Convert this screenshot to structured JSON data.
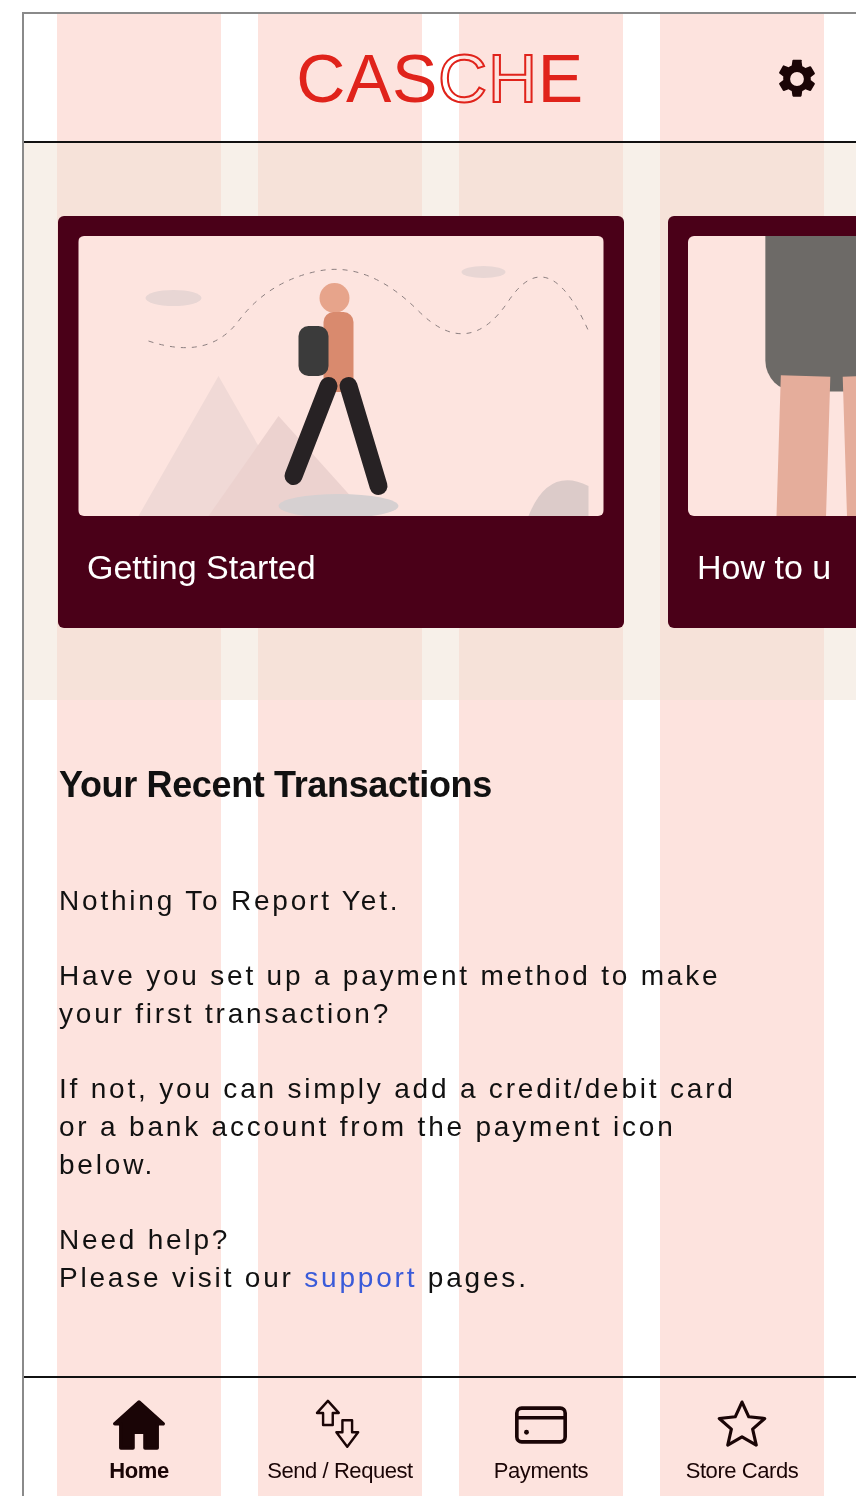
{
  "logo": [
    {
      "text": "CAS",
      "kind": "solid"
    },
    {
      "text": "CH",
      "kind": "outline"
    },
    {
      "text": "E",
      "kind": "solid"
    }
  ],
  "cards": [
    {
      "title": "Getting Started",
      "kind": "hiker"
    },
    {
      "title": "How to u",
      "kind": "shopper"
    }
  ],
  "transactions": {
    "heading": "Your Recent Transactions",
    "paragraphs": [
      "Nothing To Report Yet.",
      "Have you set up a payment method to make your first transaction?",
      "If not, you can simply add a credit/debit card or a bank account from the payment icon below."
    ],
    "help": {
      "question": "Need help?",
      "before": "Please visit our",
      "link": "support",
      "after": "pages."
    }
  },
  "tabs": [
    {
      "label": "Home",
      "kind": "home",
      "selected": true
    },
    {
      "label": "Send / Request",
      "kind": "transfer",
      "selected": false
    },
    {
      "label": "Payments",
      "kind": "card",
      "selected": false
    },
    {
      "label": "Store Cards",
      "kind": "star",
      "selected": false
    }
  ]
}
